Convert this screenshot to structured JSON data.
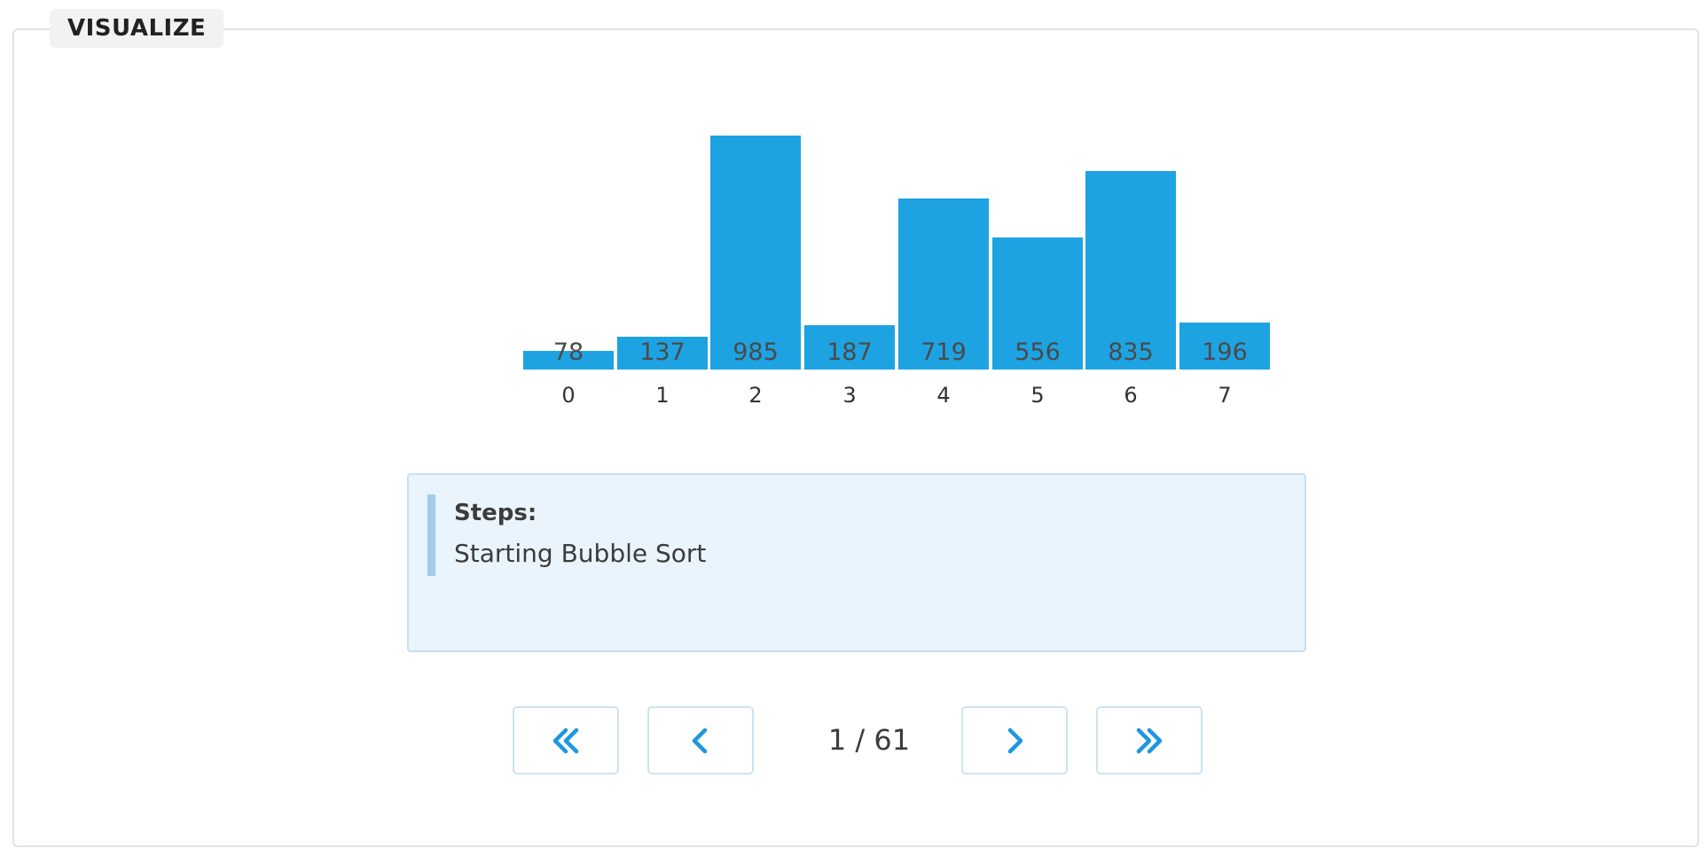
{
  "panel": {
    "legend": "VISUALIZE"
  },
  "chart_data": {
    "type": "bar",
    "categories": [
      "0",
      "1",
      "2",
      "3",
      "4",
      "5",
      "6",
      "7"
    ],
    "values": [
      78,
      137,
      985,
      187,
      719,
      556,
      835,
      196
    ],
    "ylim": [
      0,
      985
    ],
    "bar_color": "#1ea3e2",
    "grid": false
  },
  "steps": {
    "title": "Steps:",
    "text": "Starting Bubble Sort"
  },
  "navigation": {
    "first_icon": "double-chevron-left-icon",
    "prev_icon": "chevron-left-icon",
    "next_icon": "chevron-right-icon",
    "last_icon": "double-chevron-right-icon",
    "page_text": "1 / 61",
    "accent_color": "#1e96e0"
  }
}
